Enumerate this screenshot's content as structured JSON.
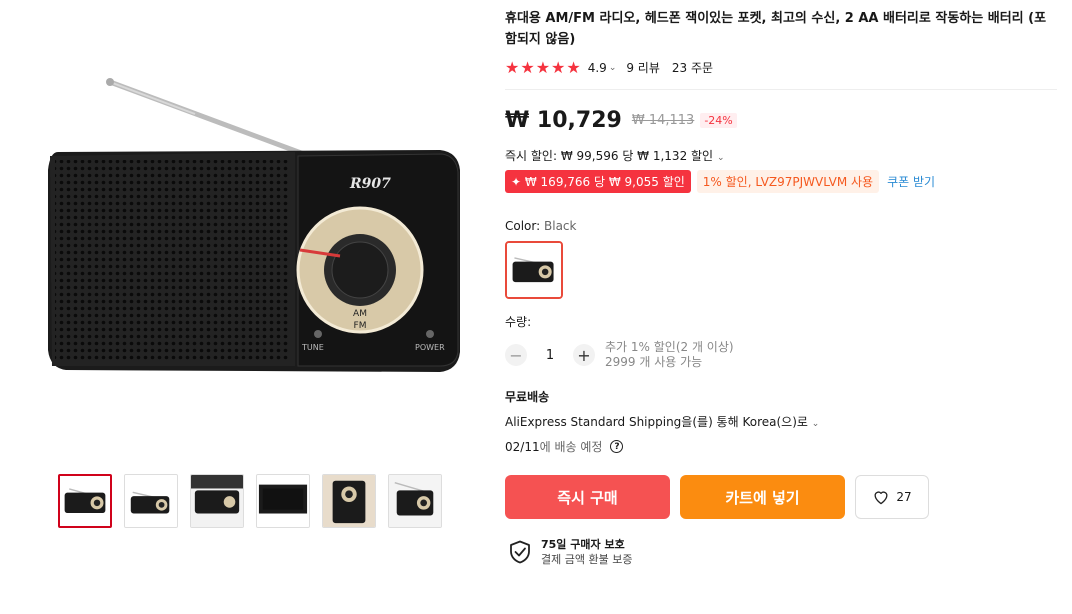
{
  "product": {
    "title": "휴대용 AM/FM 라디오, 헤드폰 잭이있는 포켓, 최고의 수신, 2 AA 배터리로 작동하는 배터리 (포함되지 않음)",
    "rating": {
      "stars": "★★★★★",
      "value": "4.9",
      "reviews": "9 리뷰",
      "orders": "23 주문"
    },
    "price": {
      "current": "₩ 10,729",
      "original": "₩ 14,113",
      "discount": "-24%"
    },
    "instant_discount": "즉시 할인: ₩ 99,596 당 ₩ 1,132 할인",
    "promos": {
      "red": "✦ ₩ 169,766 당 ₩ 9,055 할인",
      "code": "1% 할인, LVZ97PJWVLVM 사용",
      "coupon_link": "쿠폰 받기"
    },
    "color": {
      "label": "Color:",
      "value": "Black"
    },
    "quantity": {
      "label": "수량:",
      "minus": "−",
      "plus": "+",
      "value": "1",
      "extra_discount": "추가 1% 할인(2 개 이상)",
      "available": "2999 개 사용 가능"
    },
    "shipping": {
      "title": "무료배송",
      "method": "AliExpress Standard Shipping을(를) 통해 Korea(으)로",
      "date": "02/11",
      "date_suffix": "에 배송 예정",
      "help": "?"
    },
    "actions": {
      "buy_now": "즉시 구매",
      "add_to_cart": "카트에 넣기",
      "wishlist_count": "27"
    },
    "protection": {
      "line1": "75일 구매자 보호",
      "line2": "결제 금액 환불 보증"
    }
  },
  "radio": {
    "brand": "R907",
    "label_am": "AM",
    "label_fm": "FM",
    "label_tune": "TUNE",
    "label_power": "POWER"
  },
  "colors": {
    "accent_red": "#f55252",
    "accent_orange": "#fb8c10",
    "star": "#f5333f"
  }
}
